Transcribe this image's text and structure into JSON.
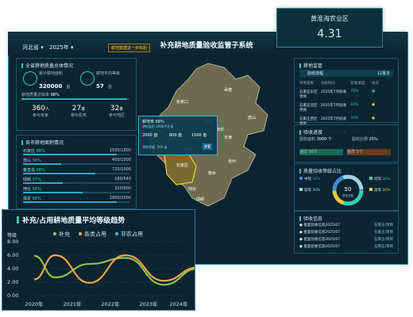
{
  "badge": {
    "label": "黄淮海农业区",
    "value": "4.31"
  },
  "header": {
    "title": "补充耕地质量验收监管子系统",
    "region": "河北省",
    "year": "2025年",
    "tag": "耕地数据进一步核验"
  },
  "left_top": {
    "title": "全省耕地质量总体情况",
    "stat1_label": "累计耕地面积",
    "stat1_value": "320000",
    "stat1_unit": "亩",
    "stat2_label": "耕地平均等级",
    "stat2_value": "57",
    "stat2_unit": "亩",
    "progress_label": "耕地质量达标率",
    "progress_value": "98%",
    "progress_fraction": 0.98,
    "circles": [
      {
        "value": "360",
        "unit": "人",
        "label": "参与专家"
      },
      {
        "value": "27",
        "unit": "家",
        "label": "参与机构"
      },
      {
        "value": "32",
        "unit": "条",
        "label": "参与地区"
      }
    ]
  },
  "left_bottom": {
    "title": "各市耕地面积情况",
    "rows": [
      {
        "name": "石家庄",
        "pct": "88%",
        "count": "1500/1800",
        "fraction": 0.88
      },
      {
        "name": "唐山",
        "pct": "36%",
        "count": "400/1000",
        "fraction": 0.36
      },
      {
        "name": "秦皇岛",
        "pct": "68%",
        "count": "720/1000",
        "fraction": 0.68
      },
      {
        "name": "邯郸",
        "pct": "37%",
        "count": "180/540",
        "fraction": 0.37
      },
      {
        "name": "邢台",
        "pct": "56%",
        "count": "320/600",
        "fraction": 0.56
      },
      {
        "name": "保定",
        "pct": "88%",
        "count": "1800/2000",
        "fraction": 0.88
      }
    ]
  },
  "map": {
    "popup_title": "耕地率 68%",
    "popup_sub": "耕地面积 3000平方米",
    "popup_v1": "2000 亩",
    "popup_v2": "800 亩",
    "popup_v3": "1500 亩",
    "popup_bottom": "耕地等级: 500 亩",
    "popup_btn": "查看",
    "labels": [
      "承德",
      "张家口",
      "唐山",
      "北京",
      "天津",
      "保定",
      "沧州",
      "石家庄",
      "衡水",
      "邢台",
      "邯郸",
      "廊坊"
    ]
  },
  "right_top": {
    "title": "耕地监管",
    "sub": "验收流程",
    "sub_right": "12批次",
    "headers": [
      "项目名称",
      "验收时间",
      "验收进度",
      "状态"
    ],
    "rows": [
      [
        "石家庄东区项目",
        "2025年7月验收",
        "72%",
        "●"
      ],
      [
        "石家庄北区项目",
        "2025年7月验收",
        "83%",
        "●"
      ],
      [
        "石家庄西区项目",
        "2025年7月验收",
        "34%",
        "●"
      ],
      [
        "石家庄南区项目",
        "2025年7月验收",
        "58%",
        "●"
      ]
    ]
  },
  "right_mid": {
    "title": "验收进度",
    "a_label": "验收面积",
    "a_value": "3000 个",
    "b_label": "验收比例",
    "b_value": "25%",
    "c_label": "通过",
    "c_value": "50个",
    "d_label": "整改",
    "d_value": "5个"
  },
  "right_ring": {
    "title": "质量验收等级占比",
    "center": "50",
    "center_label": "项目总数",
    "legend": [
      {
        "name": "优等",
        "pct": "30%",
        "color": "#2fd0b0"
      },
      {
        "name": "良等",
        "pct": "20%",
        "color": "#e7c93e"
      },
      {
        "name": "中等",
        "pct": "20%",
        "color": "#3d8bd9"
      },
      {
        "name": "低等",
        "pct": "30%",
        "color": "#9fd3e6"
      }
    ]
  },
  "right_bottom": {
    "title": "验收信息",
    "rows": [
      [
        "● 批复验收信息2025/07",
        "石家庄/项目"
      ],
      [
        "● 批复验收信息2025/07",
        "石家庄/项目"
      ],
      [
        "● 批复验收信息2025/07",
        "石家庄/项目"
      ],
      [
        "● 批复验收信息2025/07",
        "石家庄/项目"
      ]
    ]
  },
  "chart": {
    "panel_title": "补充/占用耕地质量平均等级趋势"
  },
  "chart_data": {
    "type": "line",
    "title": "",
    "ylabel": "等级",
    "xlabel": "",
    "x": [
      "2020年",
      "2021年",
      "2022年",
      "2023年",
      "2024年"
    ],
    "ylim": [
      0,
      8
    ],
    "yticks": [
      "0.00",
      "2.00",
      "4.00",
      "6.00",
      "8.00"
    ],
    "legend_position": "top",
    "series": [
      {
        "name": "补充",
        "color": "#8bc34a",
        "values": [
          5.9,
          2.7,
          4.7,
          5.6,
          1.6,
          4.0
        ]
      },
      {
        "name": "各类占用",
        "color": "#f0a24a",
        "values": [
          2.4,
          6.0,
          1.9,
          6.0,
          2.2,
          4.2
        ]
      },
      {
        "name": "非农占用",
        "color": "#48a7e8",
        "values": []
      }
    ],
    "x_points": [
      0,
      0.55,
      1.45,
      2.4,
      3.4,
      4.3
    ]
  },
  "colors": {
    "accent": "#2fd0b0",
    "panel_bg": "#0c2632",
    "frame": "#2a8aa3"
  }
}
